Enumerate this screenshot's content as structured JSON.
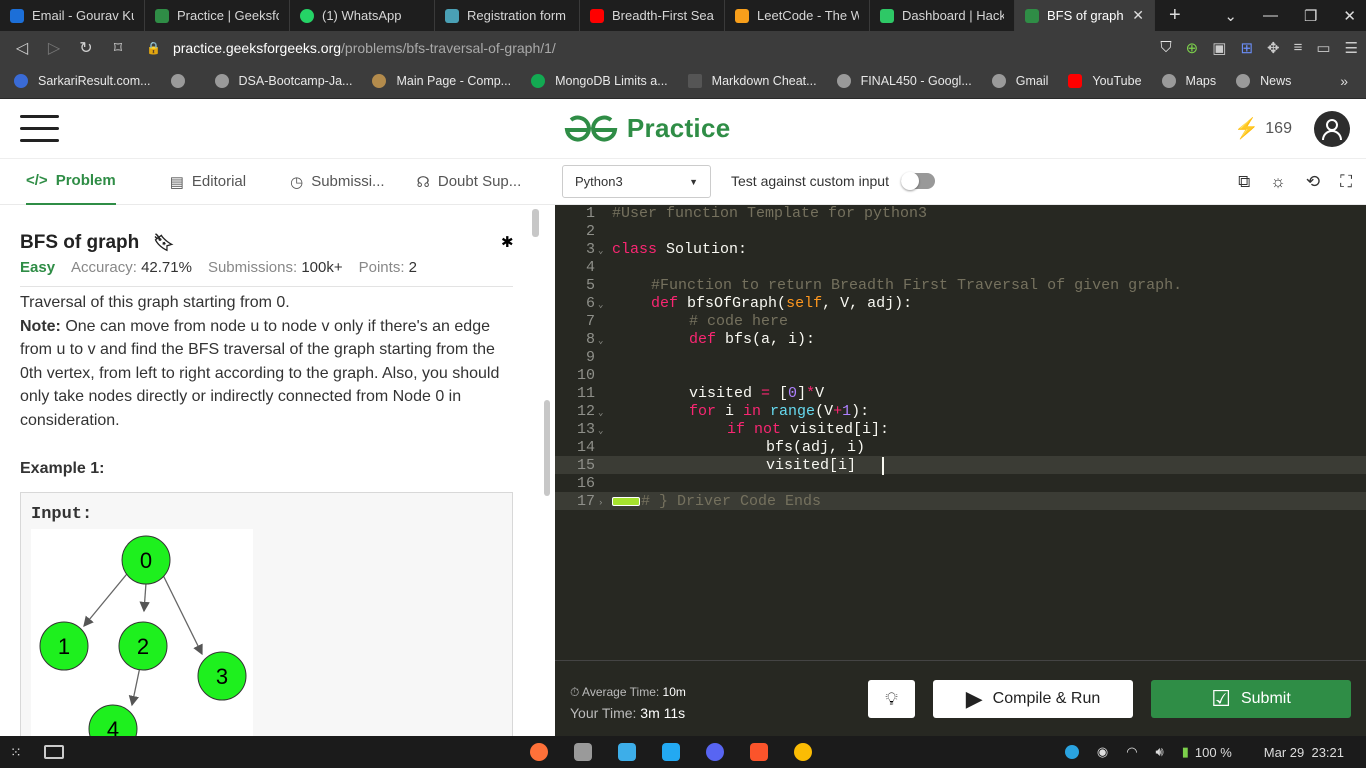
{
  "browser": {
    "tabs": [
      {
        "title": "Email - Gourav Kum",
        "color": "#1c6fd8"
      },
      {
        "title": "Practice | GeeksforG",
        "color": "#2f8d46"
      },
      {
        "title": "(1) WhatsApp",
        "color": "#25d366"
      },
      {
        "title": "Registration form fo",
        "color": "#4aa0b5"
      },
      {
        "title": "Breadth-First Searc",
        "color": "#ff0000"
      },
      {
        "title": "LeetCode - The Wo",
        "color": "#f89f1b"
      },
      {
        "title": "Dashboard | Hacke",
        "color": "#2ec866"
      },
      {
        "title": "BFS of graph | P",
        "color": "#2f8d46"
      }
    ],
    "url_host": "practice.geeksforgeeks.org",
    "url_path": "/problems/bfs-traversal-of-graph/1/",
    "bookmarks": [
      "SarkariResult.com...",
      "",
      "DSA-Bootcamp-Ja...",
      "Main Page - Comp...",
      "MongoDB Limits a...",
      "Markdown Cheat...",
      "FINAL450 - Googl...",
      "Gmail",
      "YouTube",
      "Maps",
      "News"
    ]
  },
  "header": {
    "brand": "Practice",
    "streak": "169"
  },
  "toolbar": {
    "tabs": [
      "Problem",
      "Editorial",
      "Submissi...",
      "Doubt Sup..."
    ],
    "language": "Python3",
    "custom_input_label": "Test against custom input"
  },
  "problem": {
    "title": "BFS of graph",
    "difficulty": "Easy",
    "accuracy_label": "Accuracy:",
    "accuracy": "42.71%",
    "submissions_label": "Submissions:",
    "submissions": "100k+",
    "points_label": "Points:",
    "points": "2",
    "desc_line1": "Traversal of this graph starting from 0.",
    "note_label": "Note:",
    "note_text": " One can move from node u to node v only if there's an edge from u to v and find the BFS traversal of the graph starting from the 0th vertex, from left to right according to the graph. Also, you should only take nodes directly or indirectly connected from Node 0 in consideration.",
    "example_title": "Example 1:",
    "input_label": "Input:",
    "graph_nodes": [
      "0",
      "1",
      "2",
      "3",
      "4"
    ]
  },
  "editor": {
    "lines": [
      "1",
      "2",
      "3",
      "4",
      "5",
      "6",
      "7",
      "8",
      "9",
      "10",
      "11",
      "12",
      "13",
      "14",
      "15",
      "16",
      "17"
    ],
    "l1": "#User function Template for python3",
    "l3_kw": "class",
    "l3_rest": " Solution:",
    "l5": "#Function to return Breadth First Traversal of given graph.",
    "l6_kw": "def",
    "l6_fn": "bfsOfGraph",
    "l6_self": "self",
    "l6_rest": ", V, adj):",
    "l7": "# code here",
    "l8_kw": "def",
    "l8_fn": "bfs",
    "l8_rest": "(a, i):",
    "l11_a": "visited ",
    "l11_op": "=",
    "l11_b": " [",
    "l11_num": "0",
    "l11_c": "]",
    "l11_op2": "*",
    "l11_d": "V",
    "l12_kw": "for",
    "l12_a": " i ",
    "l12_kw2": "in",
    "l12_bi": " range",
    "l12_b": "(V",
    "l12_op": "+",
    "l12_num": "1",
    "l12_c": "):",
    "l13_kw": "if",
    "l13_kw2": " not",
    "l13_rest": " visited[i]:",
    "l14": "bfs(adj, i)",
    "l15": "visited[i]  ",
    "l17": "# } Driver Code Ends"
  },
  "footer": {
    "avg_label": "Average Time:",
    "avg_value": "10m",
    "your_label": "Your Time:",
    "your_value": "3m 11s",
    "run_label": "Compile & Run",
    "submit_label": "Submit"
  },
  "taskbar": {
    "battery": "100 %",
    "datetime": "Mar 29  23:21"
  }
}
